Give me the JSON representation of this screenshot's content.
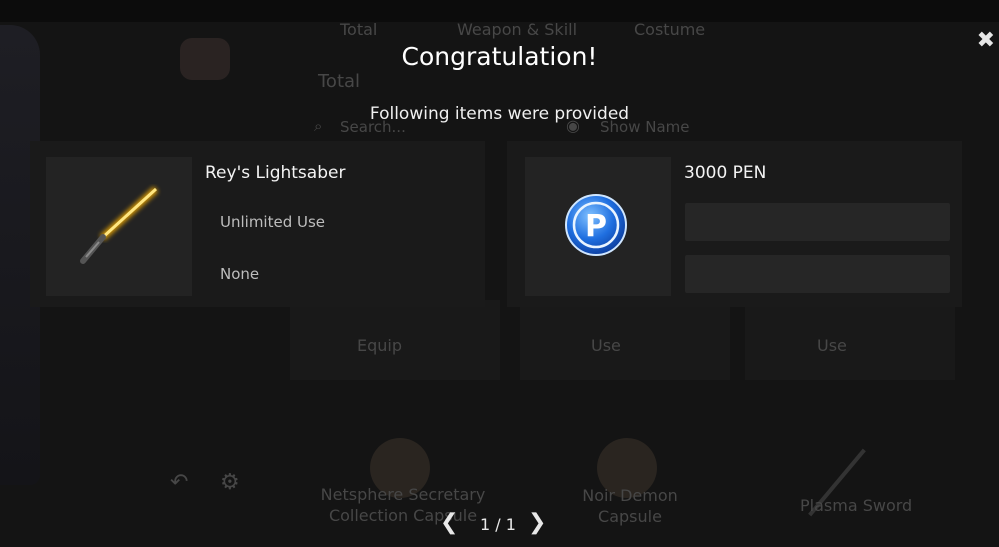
{
  "background": {
    "tabs": [
      "Total",
      "Weapon & Skill",
      "Costume"
    ],
    "section_title": "Total",
    "search_placeholder": "Search...",
    "show_name_label": "Show Name",
    "actions": [
      "Equip",
      "Use",
      "Use"
    ],
    "items": [
      "Netsphere Secretary Collection Capsule",
      "Noir Demon Capsule",
      "Plasma Sword"
    ]
  },
  "dialog": {
    "title": "Congratulation!",
    "subtitle": "Following items were provided",
    "items": [
      {
        "name": "Rey's Lightsaber",
        "duration": "Unlimited Use",
        "extra": "None",
        "icon": "lightsaber-icon"
      },
      {
        "name": "3000 PEN",
        "icon": "pen-coin-icon"
      }
    ],
    "pagination": {
      "label": "1 / 1"
    }
  },
  "colors": {
    "coin_blue": "#1f6fe0",
    "saber_yellow": "#ffd84a"
  }
}
